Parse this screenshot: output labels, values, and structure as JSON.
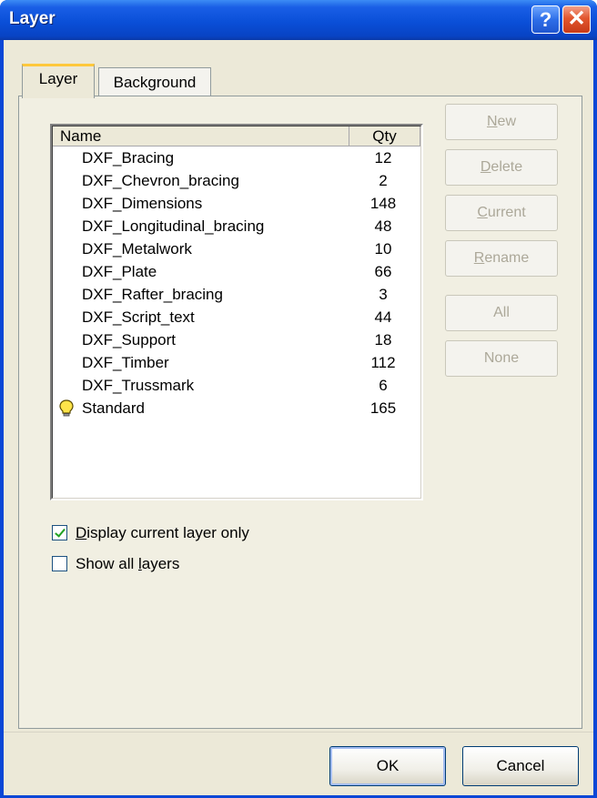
{
  "window": {
    "title": "Layer"
  },
  "titlebar": {
    "help_glyph": "?",
    "close_glyph": "✕"
  },
  "tabs": [
    {
      "label": "Layer",
      "selected": true
    },
    {
      "label": "Background",
      "selected": false
    }
  ],
  "list": {
    "columns": [
      "Name",
      "Qty"
    ],
    "rows": [
      {
        "name": "DXF_Bracing",
        "qty": "12",
        "current": false
      },
      {
        "name": "DXF_Chevron_bracing",
        "qty": "2",
        "current": false
      },
      {
        "name": "DXF_Dimensions",
        "qty": "148",
        "current": false
      },
      {
        "name": "DXF_Longitudinal_bracing",
        "qty": "48",
        "current": false
      },
      {
        "name": "DXF_Metalwork",
        "qty": "10",
        "current": false
      },
      {
        "name": "DXF_Plate",
        "qty": "66",
        "current": false
      },
      {
        "name": "DXF_Rafter_bracing",
        "qty": "3",
        "current": false
      },
      {
        "name": "DXF_Script_text",
        "qty": "44",
        "current": false
      },
      {
        "name": "DXF_Support",
        "qty": "18",
        "current": false
      },
      {
        "name": "DXF_Timber",
        "qty": "112",
        "current": false
      },
      {
        "name": "DXF_Trussmark",
        "qty": "6",
        "current": false
      },
      {
        "name": "Standard",
        "qty": "165",
        "current": true,
        "icon": "lightbulb-icon"
      }
    ]
  },
  "side_buttons": [
    {
      "label": "New",
      "mnemonic": "N",
      "enabled": false
    },
    {
      "label": "Delete",
      "mnemonic": "D",
      "enabled": false
    },
    {
      "label": "Current",
      "mnemonic": "C",
      "enabled": false
    },
    {
      "label": "Rename",
      "mnemonic": "R",
      "enabled": false
    },
    {
      "label": "All",
      "enabled": false
    },
    {
      "label": "None",
      "enabled": false
    }
  ],
  "options": [
    {
      "label": "Display current layer only",
      "checked": true
    },
    {
      "label": "Show all layers",
      "checked": false
    }
  ],
  "footer": {
    "ok_label": "OK",
    "cancel_label": "Cancel"
  },
  "colors": {
    "titlebar": "#0a4fd8",
    "dialog_face": "#ece9d8",
    "disabled_text": "#aca899",
    "close_button": "#e2562e",
    "bulb": "#ffe44a"
  }
}
